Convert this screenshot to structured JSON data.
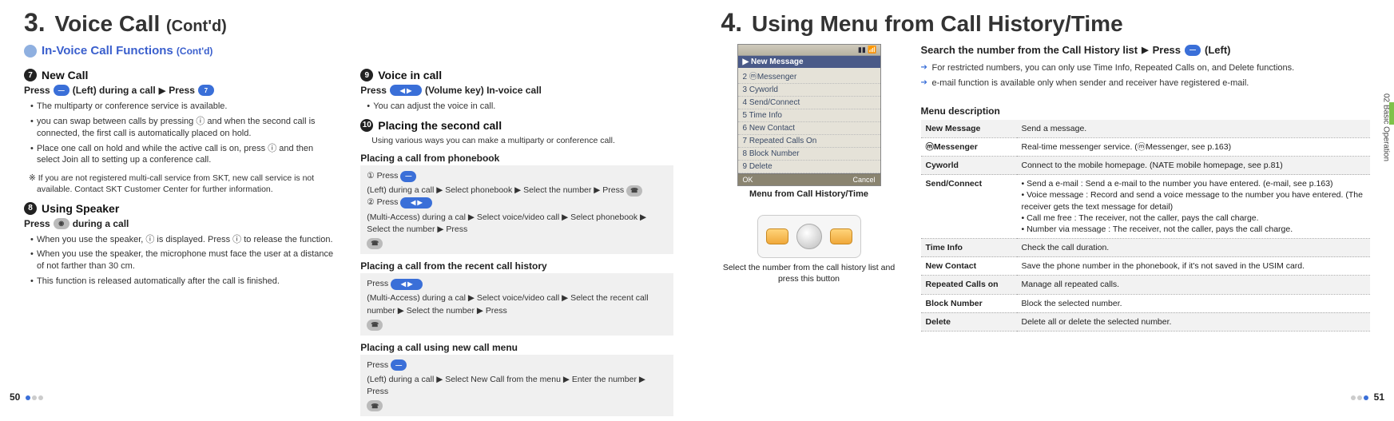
{
  "left": {
    "title_num": "3.",
    "title": "Voice Call",
    "title_contd": "(Cont'd)",
    "section_heading": "In-Voice Call Functions",
    "section_heading_contd": "(Cont'd)",
    "col1": {
      "h7_num": "7",
      "h7": "New Call",
      "h7_instr_a": "Press",
      "h7_instr_b": "(Left) during a call",
      "h7_instr_c": "Press",
      "h7_bullets": [
        "The multiparty or conference service is available.",
        "you can swap between calls by pressing ⓘ and when the second call is connected, the first call is automatically placed on hold.",
        "Place one call on hold and while the active call is on, press ⓘ and then select Join all to setting up a conference call."
      ],
      "h7_note": "※ If you are not registered multi-call service from SKT, new call  service is not available. Contact SKT Customer Center for further information.",
      "h8_num": "8",
      "h8": "Using Speaker",
      "h8_instr_a": "Press",
      "h8_instr_b": "during a call",
      "h8_bullets": [
        "When you use the speaker,  ⓘ  is displayed. Press  ⓘ  to release the function.",
        "When you use the speaker, the microphone must face the user at a distance of not farther than 30 cm.",
        "This function is released automatically after the call is finished."
      ]
    },
    "col2": {
      "h9_num": "9",
      "h9": "Voice in call",
      "h9_instr_a": "Press",
      "h9_instr_b": "(Volume key) In-voice call",
      "h9_bullet": "You can adjust the voice in call.",
      "h10_num": "10",
      "h10": "Placing the second call",
      "h10_body": "Using various ways you can make a multiparty or conference call.",
      "pb_title": "Placing a call from phonebook",
      "pb_box_1a": "① Press",
      "pb_box_1b": "(Left) during a call ▶ Select phonebook ▶ Select the number ▶ Press",
      "pb_box_2a": "② Press",
      "pb_box_2b": "(Multi-Access) during a cal ▶ Select voice/video call ▶ Select phonebook ▶ Select the number ▶ Press",
      "rh_title": "Placing a call from the recent call history",
      "rh_box_a": "Press",
      "rh_box_b": "(Multi-Access) during a cal ▶ Select voice/video call ▶ Select the recent call number ▶ Select the number ▶ Press",
      "nc_title": "Placing a call using new call menu",
      "nc_box_a": "Press",
      "nc_box_b": "(Left) during a call ▶ Select New Call from the menu ▶ Enter the number ▶ Press"
    },
    "page_num": "50"
  },
  "right": {
    "title_num": "4.",
    "title": "Using Menu from Call History/Time",
    "phone": {
      "header": "▶ New Message",
      "items": [
        "2 ⓜMessenger",
        "3 Cyworld",
        "4 Send/Connect",
        "5 Time Info",
        "6 New Contact",
        "7 Repeated Calls On",
        "8 Block Number",
        "9 Delete"
      ],
      "soft_left": "OK",
      "soft_right": "Cancel",
      "caption1": "Menu from Call History/Time",
      "caption2": "Select the number from the call history list and press this button"
    },
    "search_line_a": "Search the number from the Call History list",
    "search_line_b": "Press",
    "search_line_c": "(Left)",
    "arrow_bullets": [
      "For restricted numbers, you can only use Time Info, Repeated Calls on, and Delete functions.",
      "e-mail function is available only when sender and receiver have registered e-mail."
    ],
    "menu_desc_title": "Menu description",
    "menu_rows": [
      {
        "label": "New Message",
        "desc": "Send a message."
      },
      {
        "label": "ⓜMessenger",
        "desc": "Real-time messenger service.  (ⓜMessenger, see p.163)"
      },
      {
        "label": "Cyworld",
        "desc": "Connect to the mobile homepage. (NATE mobile homepage, see p.81)"
      },
      {
        "label": "Send/Connect",
        "desc": "• Send a e-mail : Send a e-mail to the number you have entered. (e-mail, see p.163)\n• Voice message : Record and send a voice message to the number you have entered. (The receiver gets the text message for detail)\n• Call me free : The receiver, not the caller, pays the call charge.\n• Number via message : The receiver, not the caller, pays the call charge."
      },
      {
        "label": "Time Info",
        "desc": "Check the call duration."
      },
      {
        "label": "New Contact",
        "desc": "Save the phone number in the phonebook, if it's not saved in the USIM card."
      },
      {
        "label": "Repeated Calls on",
        "desc": "Manage all repeated calls."
      },
      {
        "label": "Block Number",
        "desc": "Block the selected number."
      },
      {
        "label": "Delete",
        "desc": "Delete all or delete the selected number."
      }
    ],
    "side_tab": "02  Basic Operation",
    "page_num": "51"
  },
  "glyphs": {
    "arrow": "▶",
    "key_left": "—",
    "key_vol": "◀ ▶",
    "key_call": "☎",
    "key_num": "7"
  }
}
